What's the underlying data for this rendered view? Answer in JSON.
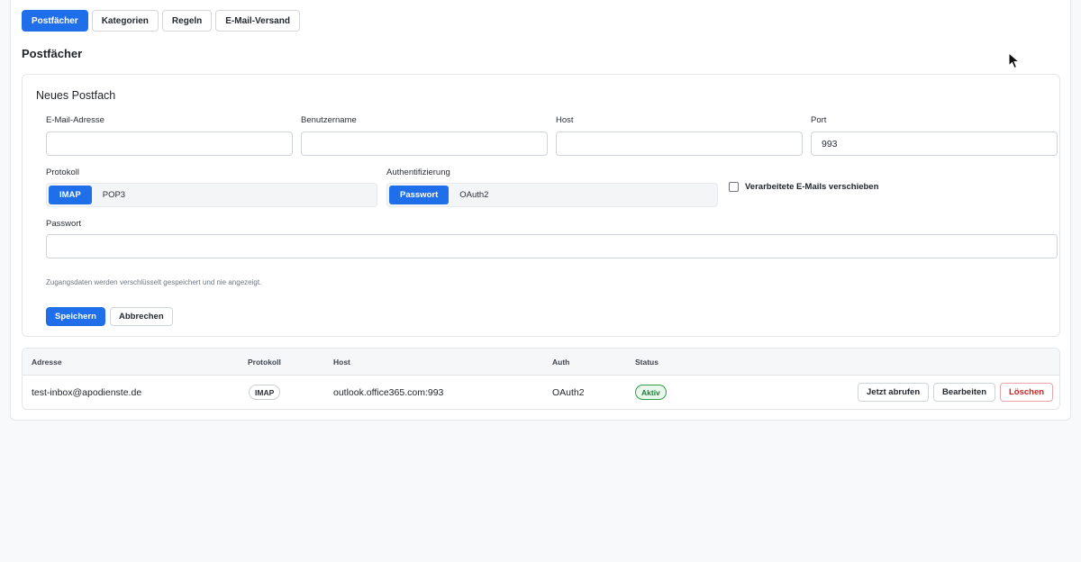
{
  "tabs": [
    {
      "label": "Postfächer",
      "active": true
    },
    {
      "label": "Kategorien",
      "active": false
    },
    {
      "label": "Regeln",
      "active": false
    },
    {
      "label": "E-Mail-Versand",
      "active": false
    }
  ],
  "section_title": "Postfächer",
  "form": {
    "title": "Neues Postfach",
    "email_label": "E-Mail-Adresse",
    "email_value": "",
    "username_label": "Benutzername",
    "username_value": "",
    "host_label": "Host",
    "host_value": "",
    "port_label": "Port",
    "port_value": "993",
    "protocol_label": "Protokoll",
    "protocol_options": [
      "IMAP",
      "POP3"
    ],
    "protocol_selected": "IMAP",
    "auth_label": "Authentifizierung",
    "auth_options": [
      "Passwort",
      "OAuth2"
    ],
    "auth_selected": "Passwort",
    "move_checkbox_label": "Verarbeitete E-Mails verschieben",
    "move_checked": false,
    "password_label": "Passwort",
    "password_value": "",
    "hint": "Zugangsdaten werden verschlüsselt gespeichert und nie angezeigt.",
    "save_label": "Speichern",
    "cancel_label": "Abbrechen"
  },
  "table": {
    "headers": {
      "address": "Adresse",
      "protocol": "Protokoll",
      "host": "Host",
      "auth": "Auth",
      "status": "Status"
    },
    "rows": [
      {
        "address": "test-inbox@apodienste.de",
        "protocol": "IMAP",
        "host": "outlook.office365.com:993",
        "auth": "OAuth2",
        "status": "Aktiv",
        "fetch_label": "Jetzt abrufen",
        "edit_label": "Bearbeiten",
        "delete_label": "Löschen"
      }
    ]
  },
  "colors": {
    "accent": "#1f6feb",
    "success": "#1a7f37",
    "danger": "#c62828"
  }
}
